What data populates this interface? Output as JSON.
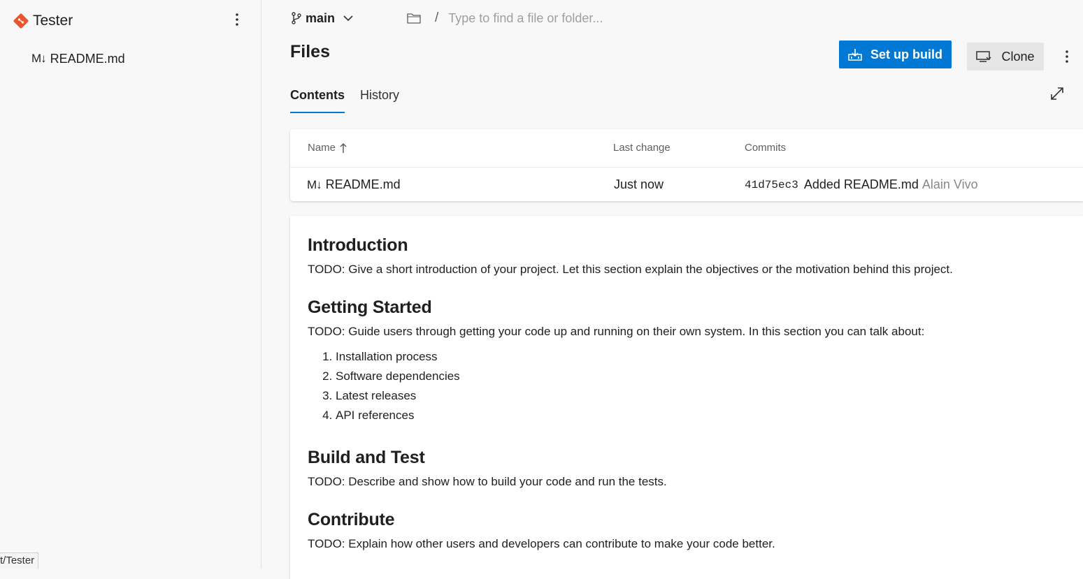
{
  "sidebar": {
    "repo_name": "Tester",
    "tree_items": [
      {
        "icon": "M↓",
        "label": "README.md"
      }
    ],
    "status_path": "t/Tester"
  },
  "topbar": {
    "branch": "main",
    "path_separator": "/",
    "path_placeholder": "Type to find a file or folder..."
  },
  "header": {
    "title": "Files",
    "setup_build_label": "Set up build",
    "clone_label": "Clone"
  },
  "tabs": [
    {
      "label": "Contents",
      "active": true
    },
    {
      "label": "History",
      "active": false
    }
  ],
  "file_table": {
    "columns": {
      "name": "Name",
      "last_change": "Last change",
      "commits": "Commits"
    },
    "rows": [
      {
        "icon": "M↓",
        "name": "README.md",
        "last_change": "Just now",
        "commit_id": "41d75ec3",
        "commit_message": "Added README.md",
        "author": "Alain Vivo"
      }
    ]
  },
  "readme": {
    "sections": [
      {
        "heading": "Introduction",
        "body": "TODO: Give a short introduction of your project. Let this section explain the objectives or the motivation behind this project."
      },
      {
        "heading": "Getting Started",
        "body": "TODO: Guide users through getting your code up and running on their own system. In this section you can talk about:",
        "list": [
          "Installation process",
          "Software dependencies",
          "Latest releases",
          "API references"
        ]
      },
      {
        "heading": "Build and Test",
        "body": "TODO: Describe and show how to build your code and run the tests."
      },
      {
        "heading": "Contribute",
        "body": "TODO: Explain how other users and developers can contribute to make your code better."
      }
    ]
  },
  "colors": {
    "accent": "#0078d4",
    "repo_icon": "#e8552f",
    "background": "#f8f8f8"
  }
}
